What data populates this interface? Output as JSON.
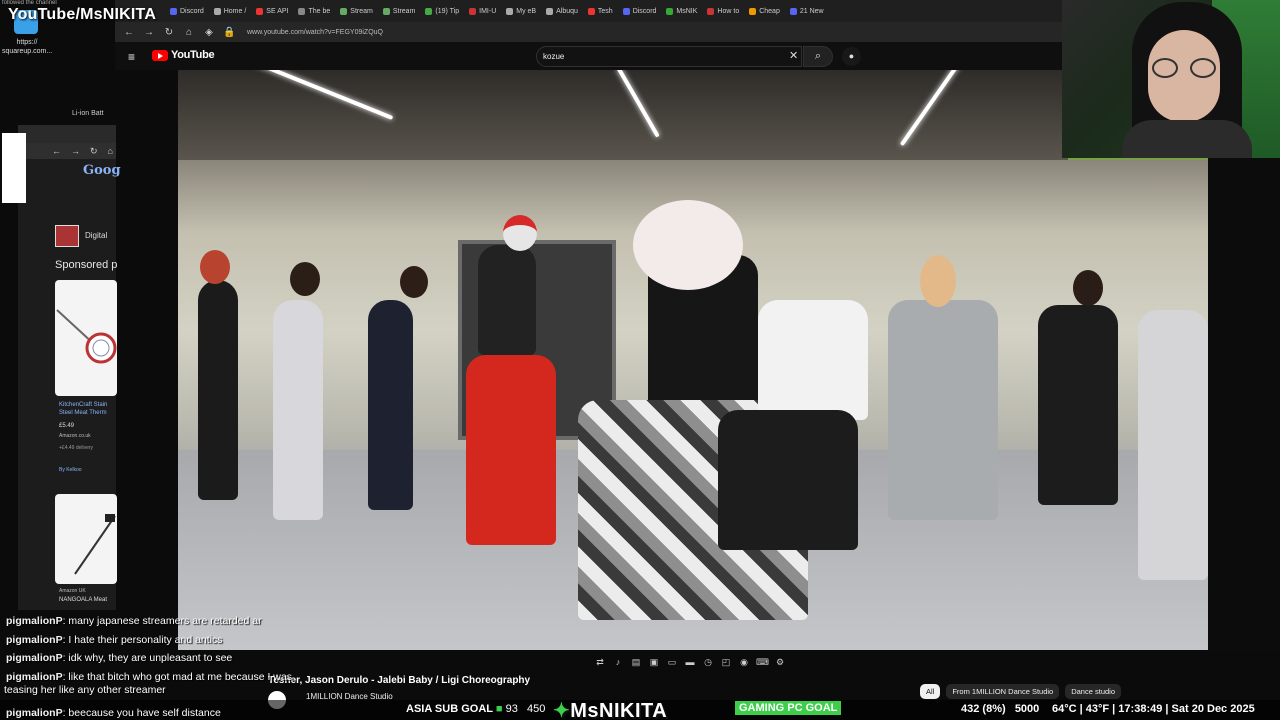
{
  "stream": {
    "title": "YouTube/MsNIKITA",
    "top_small_text": "followed the channel",
    "shortcut_label": "https:// squareup.com..."
  },
  "back_window": {
    "li_ion": "Li-ion Batt",
    "google_logo": "Goog",
    "digital_label": "Digital",
    "sponsored": "Sponsored p",
    "product1": {
      "title": "KitchenCraft Stain Steel Meat Therm",
      "price": "£5.49",
      "store": "Amazon.co.uk",
      "delivery": "+£4.49 delivery",
      "by": "By Kelkoo"
    },
    "product2": {
      "store": "Amazon UK",
      "title": "NANGOALA Meat"
    }
  },
  "browser": {
    "tabs": [
      {
        "label": "Discord",
        "color": "#5865f2"
      },
      {
        "label": "Home /",
        "color": "#aaa"
      },
      {
        "label": "SE API",
        "color": "#e33"
      },
      {
        "label": "The be",
        "color": "#888"
      },
      {
        "label": "Stream",
        "color": "#6a6"
      },
      {
        "label": "Stream",
        "color": "#6a6"
      },
      {
        "label": "(19) Tip",
        "color": "#4a4"
      },
      {
        "label": "IMI-U",
        "color": "#c33"
      },
      {
        "label": "My eB",
        "color": "#aaa"
      },
      {
        "label": "Albuqu",
        "color": "#aaa"
      },
      {
        "label": "Tesh",
        "color": "#e33"
      },
      {
        "label": "Discord",
        "color": "#5865f2"
      },
      {
        "label": "MsNIK",
        "color": "#3a3"
      },
      {
        "label": "How to",
        "color": "#c33"
      },
      {
        "label": "Cheap",
        "color": "#e90"
      },
      {
        "label": "21 New",
        "color": "#5865f2"
      }
    ],
    "url": "www.youtube.com/watch?v=FEGY09iZQuQ"
  },
  "youtube": {
    "logo_text": "YouTube",
    "search_value": "kozue",
    "video_title": "Tesher, Jason Derulo - Jalebi Baby / Ligi Choreography",
    "channel_name": "1MILLION Dance Studio",
    "chips": [
      "All",
      "From 1MILLION Dance Studio",
      "Dance studio"
    ]
  },
  "chat": [
    {
      "user": "pigmalionP",
      "text": ": many japanese streamers are retarded ar"
    },
    {
      "user": "pigmalionP",
      "text": ": I hate their personality and antics"
    },
    {
      "user": "pigmalionP",
      "text": ": idk why, they are unpleasant to see"
    },
    {
      "user": "pigmalionP",
      "text": ": like that bitch who got mad at me because I was"
    },
    {
      "user": "pigmalionP",
      "text": ": beecause you have self distance"
    }
  ],
  "chat_continuation": "teasing her like any other streamer",
  "ticker": {
    "goal1_label": "ASIA SUB GOAL",
    "goal1_current": "93",
    "goal1_target": "450",
    "brand": "MsNIKITA",
    "goal2_label": "GAMING PC GOAL",
    "goal2_progress": "432 (8%)",
    "goal2_target": "5000",
    "stats": "64°C | 43°F | 17:38:49 | Sat 20 Dec 2025"
  },
  "colors": {
    "accent_green": "#3ecf4a",
    "youtube_red": "#ff0000"
  }
}
